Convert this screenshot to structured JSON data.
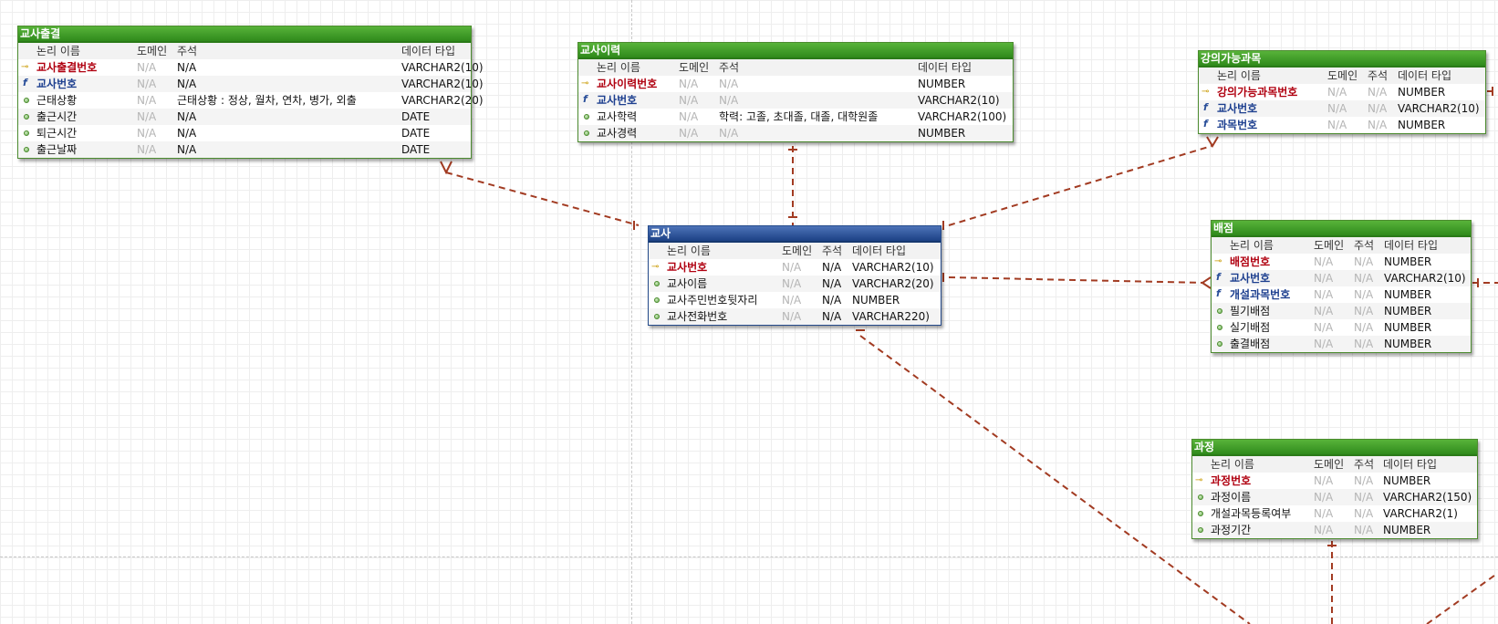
{
  "colors": {
    "relation_line": "#a23b22",
    "entity_border": "#4c8b2f",
    "entity_title": "#2f8a1b",
    "main_entity_title": "#1c4185",
    "pk_text": "#b00010",
    "fk_text": "#1d3f8f"
  },
  "headers": {
    "name": "논리 이름",
    "domain": "도메인",
    "comment": "주석",
    "type": "데이터 타입"
  },
  "entities": {
    "attendance": {
      "title": "교사출결",
      "rows": [
        {
          "kind": "pk",
          "name": "교사출결번호",
          "domain": "N/A",
          "comment": "N/A",
          "type": "VARCHAR2(10)"
        },
        {
          "kind": "fk",
          "name": "교사번호",
          "domain": "N/A",
          "comment": "N/A",
          "type": "VARCHAR2(10)"
        },
        {
          "kind": "attr",
          "name": "근태상황",
          "domain": "N/A",
          "comment": "근태상황 : 정상, 월차, 연차, 병가, 외출",
          "type": "VARCHAR2(20)"
        },
        {
          "kind": "attr",
          "name": "출근시간",
          "domain": "N/A",
          "comment": "N/A",
          "type": "DATE"
        },
        {
          "kind": "attr",
          "name": "퇴근시간",
          "domain": "N/A",
          "comment": "N/A",
          "type": "DATE"
        },
        {
          "kind": "attr",
          "name": "출근날짜",
          "domain": "N/A",
          "comment": "N/A",
          "type": "DATE"
        }
      ]
    },
    "history": {
      "title": "교사이력",
      "rows": [
        {
          "kind": "pk",
          "name": "교사이력번호",
          "domain": "N/A",
          "comment": "N/A",
          "type": "NUMBER"
        },
        {
          "kind": "fk",
          "name": "교사번호",
          "domain": "N/A",
          "comment": "N/A",
          "type": "VARCHAR2(10)"
        },
        {
          "kind": "attr",
          "name": "교사학력",
          "domain": "N/A",
          "comment": "학력: 고졸, 초대졸, 대졸, 대학원졸",
          "type": "VARCHAR2(100)"
        },
        {
          "kind": "attr",
          "name": "교사경력",
          "domain": "N/A",
          "comment": "N/A",
          "type": "NUMBER"
        }
      ]
    },
    "subjects": {
      "title": "강의가능과목",
      "rows": [
        {
          "kind": "pk",
          "name": "강의가능과목번호",
          "domain": "N/A",
          "comment": "N/A",
          "type": "NUMBER"
        },
        {
          "kind": "fk",
          "name": "교사번호",
          "domain": "N/A",
          "comment": "N/A",
          "type": "VARCHAR2(10)"
        },
        {
          "kind": "fk",
          "name": "과목번호",
          "domain": "N/A",
          "comment": "N/A",
          "type": "NUMBER"
        }
      ]
    },
    "teacher": {
      "title": "교사",
      "rows": [
        {
          "kind": "pk",
          "name": "교사번호",
          "domain": "N/A",
          "comment": "N/A",
          "type": "VARCHAR2(10)"
        },
        {
          "kind": "attr",
          "name": "교사이름",
          "domain": "N/A",
          "comment": "N/A",
          "type": "VARCHAR2(20)"
        },
        {
          "kind": "attr",
          "name": "교사주민번호뒷자리",
          "domain": "N/A",
          "comment": "N/A",
          "type": "NUMBER"
        },
        {
          "kind": "attr",
          "name": "교사전화번호",
          "domain": "N/A",
          "comment": "N/A",
          "type": "VARCHAR220)"
        }
      ]
    },
    "allocation": {
      "title": "배점",
      "rows": [
        {
          "kind": "pk",
          "name": "배점번호",
          "domain": "N/A",
          "comment": "N/A",
          "type": "NUMBER"
        },
        {
          "kind": "fk",
          "name": "교사번호",
          "domain": "N/A",
          "comment": "N/A",
          "type": "VARCHAR2(10)"
        },
        {
          "kind": "fk",
          "name": "개설과목번호",
          "domain": "N/A",
          "comment": "N/A",
          "type": "NUMBER"
        },
        {
          "kind": "attr",
          "name": "필기배점",
          "domain": "N/A",
          "comment": "N/A",
          "type": "NUMBER"
        },
        {
          "kind": "attr",
          "name": "실기배점",
          "domain": "N/A",
          "comment": "N/A",
          "type": "NUMBER"
        },
        {
          "kind": "attr",
          "name": "출결배점",
          "domain": "N/A",
          "comment": "N/A",
          "type": "NUMBER"
        }
      ]
    },
    "course": {
      "title": "과정",
      "rows": [
        {
          "kind": "pk",
          "name": "과정번호",
          "domain": "N/A",
          "comment": "N/A",
          "type": "NUMBER"
        },
        {
          "kind": "attr",
          "name": "과정이름",
          "domain": "N/A",
          "comment": "N/A",
          "type": "VARCHAR2(150)"
        },
        {
          "kind": "attr",
          "name": "개설과목등록여부",
          "domain": "N/A",
          "comment": "N/A",
          "type": "VARCHAR2(1)"
        },
        {
          "kind": "attr",
          "name": "과정기간",
          "domain": "N/A",
          "comment": "N/A",
          "type": "NUMBER"
        }
      ]
    }
  }
}
